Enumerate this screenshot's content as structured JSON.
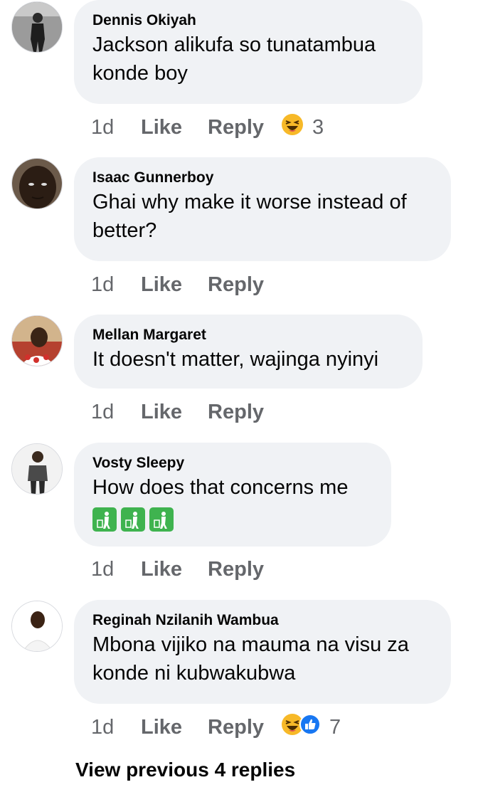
{
  "comments": [
    {
      "author": "Dennis Okiyah",
      "text": "Jackson alikufa so tunatambua konde boy",
      "time": "1d",
      "like_label": "Like",
      "reply_label": "Reply",
      "reaction_count": "3",
      "reactions": [
        "laughing-face-icon"
      ]
    },
    {
      "author": "Isaac Gunnerboy",
      "text": "Ghai why make it worse instead of better?",
      "time": "1d",
      "like_label": "Like",
      "reply_label": "Reply"
    },
    {
      "author": "Mellan Margaret",
      "text": "It doesn't matter, wajinga nyinyi",
      "time": "1d",
      "like_label": "Like",
      "reply_label": "Reply"
    },
    {
      "author": "Vosty Sleepy",
      "text": "How does that concerns me",
      "emojis": [
        "litter-bin-icon",
        "litter-bin-icon",
        "litter-bin-icon"
      ],
      "time": "1d",
      "like_label": "Like",
      "reply_label": "Reply"
    },
    {
      "author": "Reginah Nzilanih Wambua",
      "text": "Mbona vijiko na mauma na visu za konde ni kubwakubwa",
      "time": "1d",
      "like_label": "Like",
      "reply_label": "Reply",
      "reaction_count": "7",
      "reactions": [
        "laughing-face-icon",
        "like-thumb-icon"
      ]
    }
  ],
  "view_previous": "View previous 4 replies",
  "colors": {
    "bubble": "#f0f2f5",
    "meta": "#65676b",
    "like_blue": "#1877f2",
    "haha_yellow": "#f7b928",
    "emoji_green": "#3fb34f"
  }
}
